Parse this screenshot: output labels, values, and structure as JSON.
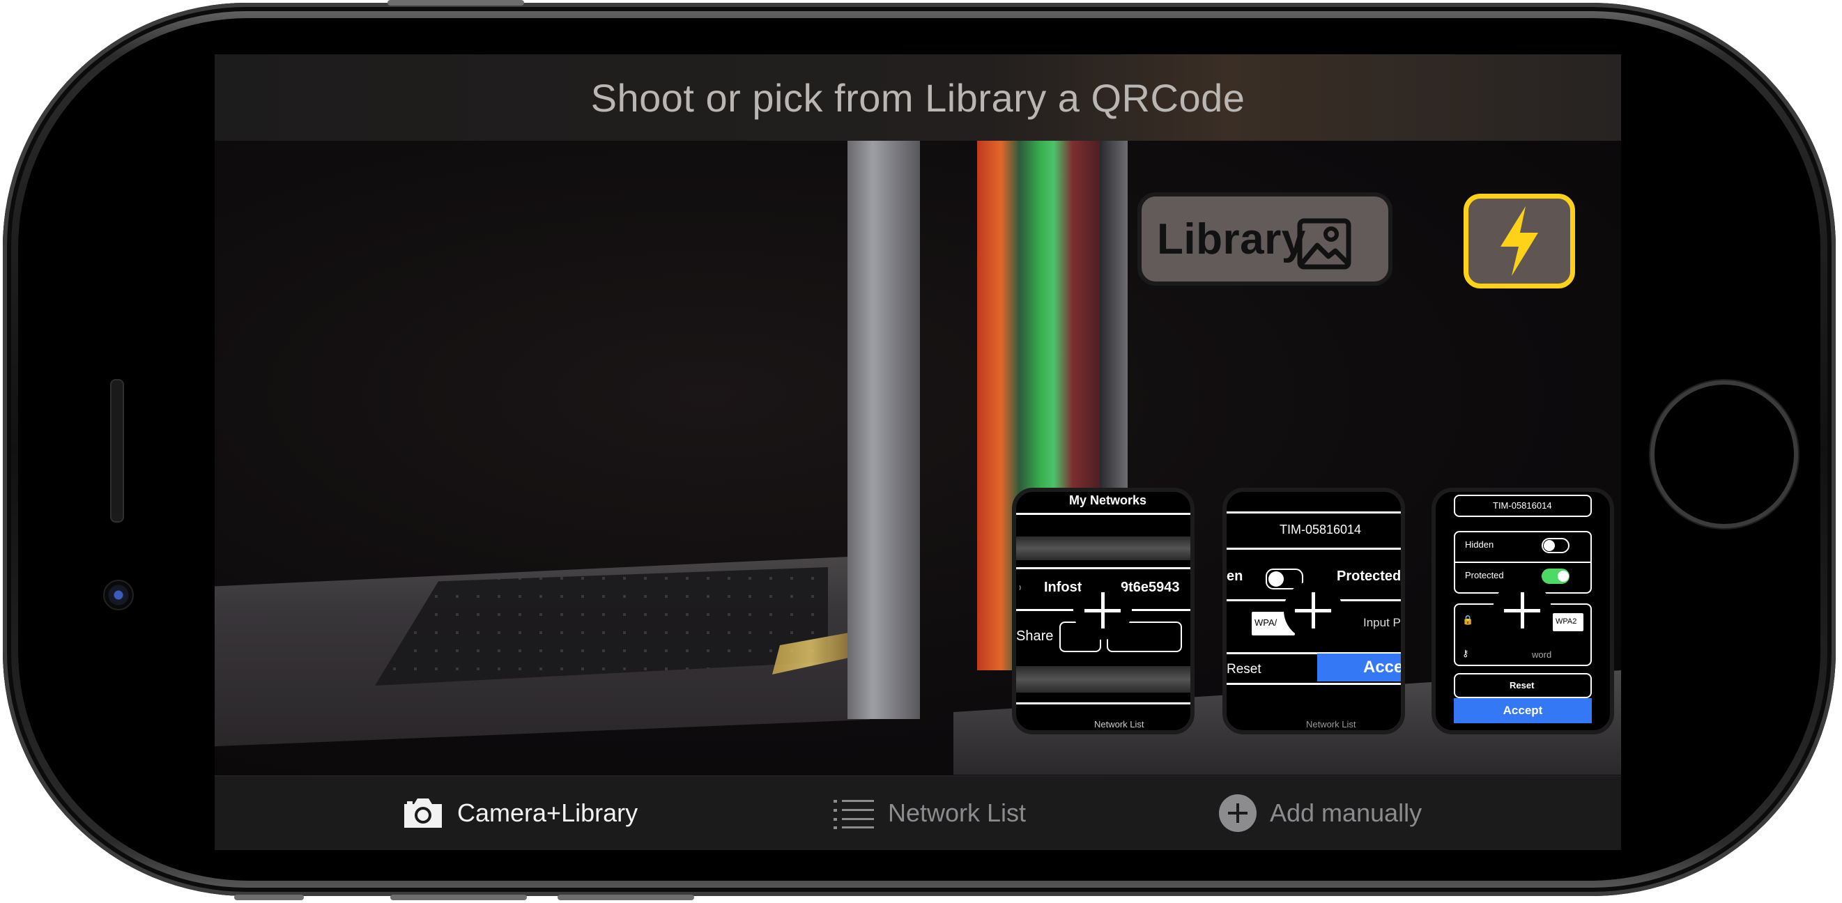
{
  "header": {
    "title": "Shoot or pick from Library a QRCode"
  },
  "controls": {
    "library_label": "Library",
    "library_icon": "photo-icon",
    "flash_icon": "lightning-bolt-icon",
    "flash_border_color": "#ffd21a"
  },
  "cards": {
    "card1": {
      "title": "My Networks",
      "network_row": "Infost",
      "network_suffix": "9t6e5943",
      "share_label": "Share",
      "footer": "Network List"
    },
    "card2": {
      "ssid": "TIM-05816014",
      "hidden_partial": "en",
      "protected_label": "Protected",
      "security": "WPA/",
      "input_partial": "Input Pa",
      "reset_label": "Reset",
      "accept_partial": "Accep",
      "footer": "Network List"
    },
    "card3": {
      "ssid": "TIM-05816014",
      "hidden_label": "Hidden",
      "protected_label": "Protected",
      "security": "WPA2",
      "password_partial": "word",
      "reset_label": "Reset",
      "accept_label": "Accept"
    }
  },
  "tabbar": {
    "camera_label": "Camera+Library",
    "camera_icon": "camera-icon",
    "list_label": "Network List",
    "list_icon": "list-icon",
    "add_label": "Add manually",
    "add_icon": "plus-circle-icon"
  }
}
